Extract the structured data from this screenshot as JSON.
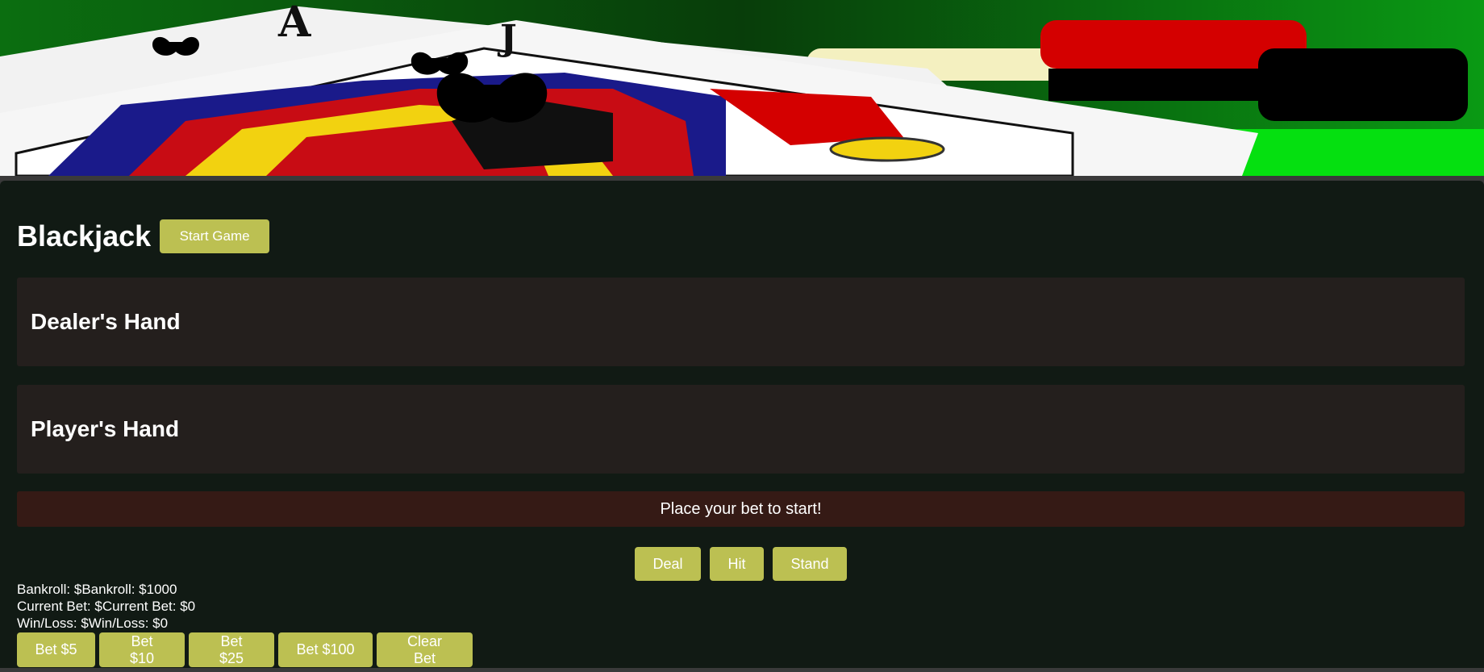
{
  "banner": {
    "image": "playing-cards-photo",
    "card_rank": "A",
    "card_rank_2": "J"
  },
  "header": {
    "title": "Blackjack",
    "start_label": "Start Game"
  },
  "dealer": {
    "heading": "Dealer's Hand"
  },
  "player": {
    "heading": "Player's Hand"
  },
  "message": "Place your bet to start!",
  "actions": {
    "deal": "Deal",
    "hit": "Hit",
    "stand": "Stand"
  },
  "stats": {
    "bankroll": "Bankroll: $Bankroll: $1000",
    "current_bet": "Current Bet: $Current Bet: $0",
    "win_loss": "Win/Loss: $Win/Loss: $0"
  },
  "bets": {
    "b5": "Bet $5",
    "b10": "Bet $10",
    "b25": "Bet $25",
    "b100": "Bet $100",
    "clear": "Clear Bet"
  },
  "colors": {
    "button": "#bcc052",
    "panel": "#111a14",
    "hand_box": "#241f1d",
    "message_box": "#351a15"
  }
}
